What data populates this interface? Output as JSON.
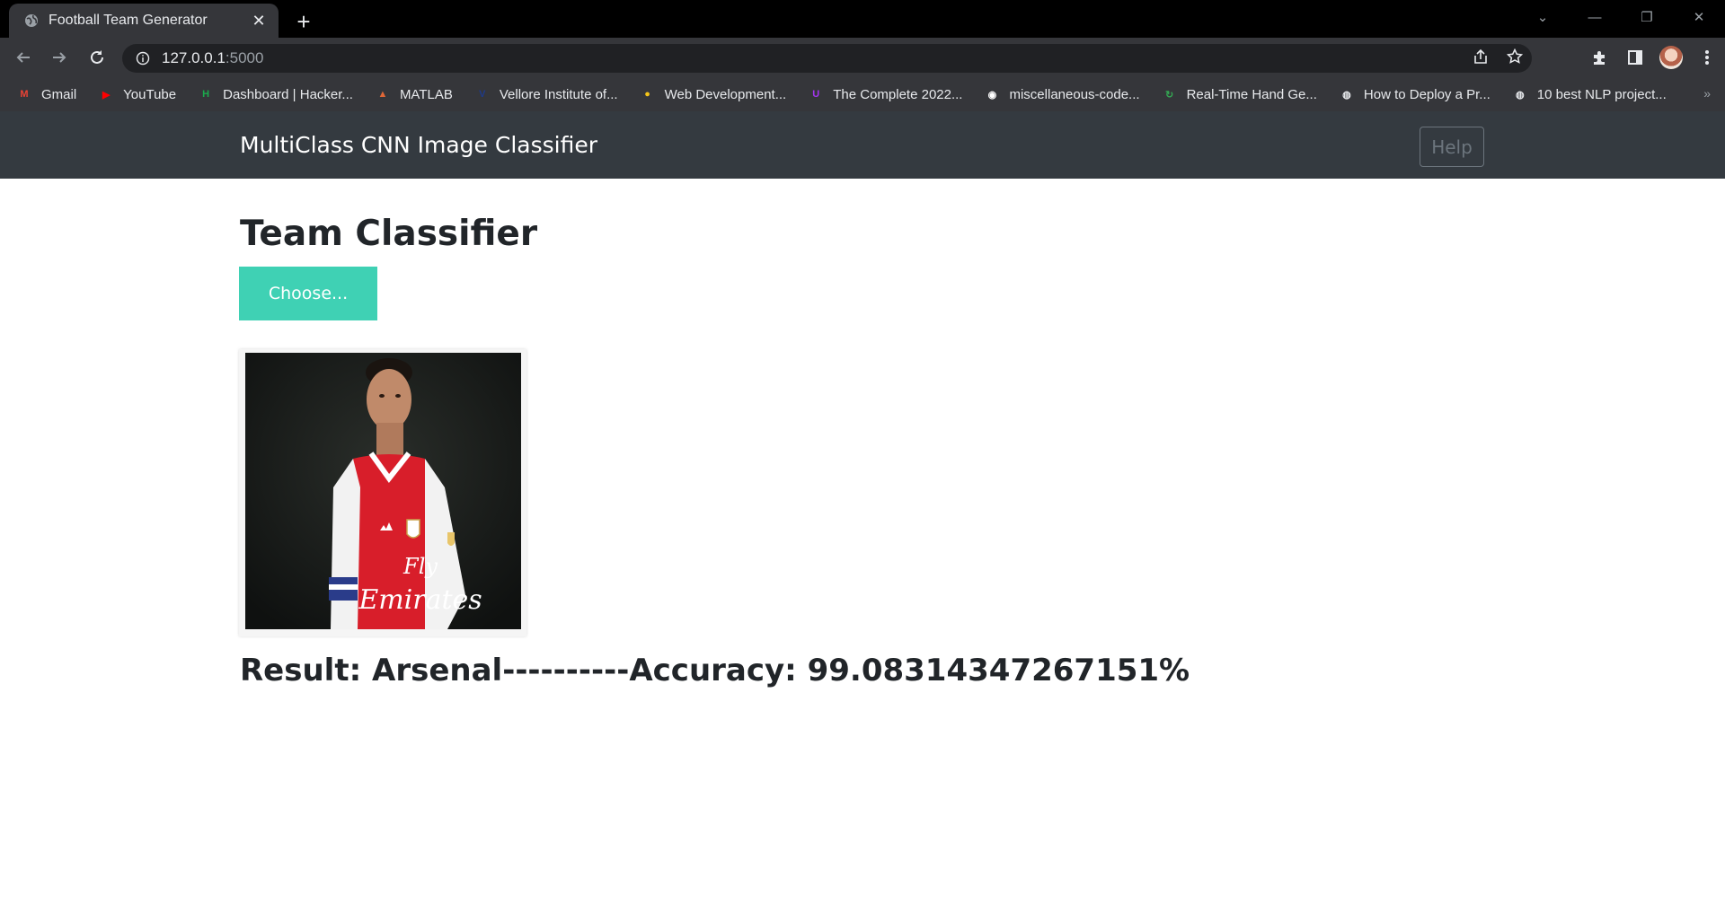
{
  "browser": {
    "tab_title": "Football Team Generator",
    "url_host": "127.0.0.1",
    "url_port": ":5000",
    "bookmarks": [
      {
        "label": "Gmail",
        "icon": "gmail-icon",
        "color": "#ea4335"
      },
      {
        "label": "YouTube",
        "icon": "youtube-icon",
        "color": "#ff0000"
      },
      {
        "label": "Dashboard | Hacker...",
        "icon": "hackerrank-icon",
        "color": "#1ba94c"
      },
      {
        "label": "MATLAB",
        "icon": "matlab-icon",
        "color": "#e16737"
      },
      {
        "label": "Vellore Institute of...",
        "icon": "vit-icon",
        "color": "#1e3a8a"
      },
      {
        "label": "Web Development...",
        "icon": "udemy-badge-icon",
        "color": "#f5c518"
      },
      {
        "label": "The Complete 2022...",
        "icon": "udemy-icon",
        "color": "#a435f0"
      },
      {
        "label": "miscellaneous-code...",
        "icon": "github-icon",
        "color": "#ffffff"
      },
      {
        "label": "Real-Time Hand Ge...",
        "icon": "refresh-green-icon",
        "color": "#34a853"
      },
      {
        "label": "How to Deploy a Pr...",
        "icon": "globe-icon",
        "color": "#e8eaed"
      },
      {
        "label": "10 best NLP project...",
        "icon": "globe-icon",
        "color": "#e8eaed"
      }
    ]
  },
  "navbar": {
    "brand": "MultiClass CNN Image Classifier",
    "help_label": "Help"
  },
  "main": {
    "title": "Team Classifier",
    "choose_label": "Choose...",
    "result_text": "Result: Arsenal----------Accuracy: 99.08314347267151%"
  },
  "image": {
    "shirt_text_line1": "Fly",
    "shirt_text_line2": "Emirates"
  }
}
